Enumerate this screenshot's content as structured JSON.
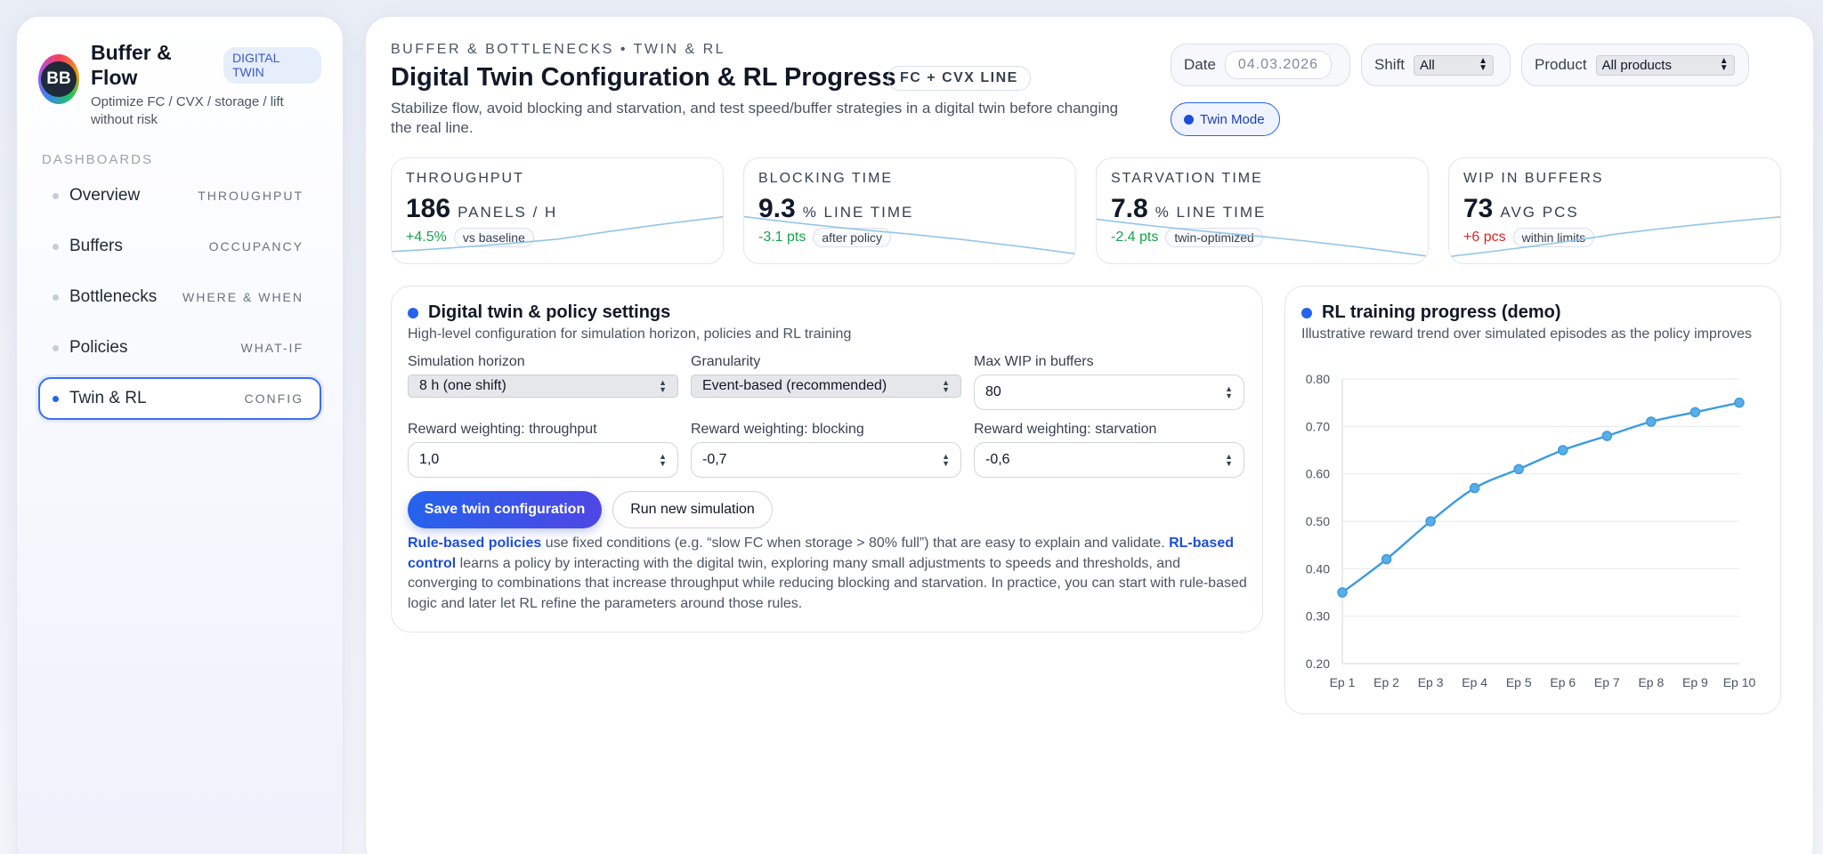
{
  "sidebar": {
    "logo_text": "BB",
    "title": "Buffer & Flow",
    "badge": "DIGITAL TWIN",
    "subtitle": "Optimize FC / CVX / storage / lift without risk",
    "section_heading": "DASHBOARDS",
    "items": [
      {
        "label": "Overview",
        "tag": "THROUGHPUT",
        "active": false
      },
      {
        "label": "Buffers",
        "tag": "OCCUPANCY",
        "active": false
      },
      {
        "label": "Bottlenecks",
        "tag": "WHERE & WHEN",
        "active": false
      },
      {
        "label": "Policies",
        "tag": "WHAT-IF",
        "active": false
      },
      {
        "label": "Twin & RL",
        "tag": "CONFIG",
        "active": true
      }
    ]
  },
  "header": {
    "eyebrow": "BUFFER & BOTTLENECKS • TWIN & RL",
    "title": "Digital Twin Configuration & RL Progress",
    "line_badge": "FC + CVX LINE",
    "subtitle": "Stabilize flow, avoid blocking and starvation, and test speed/buffer strategies in a digital twin before changing the real line.",
    "filters": {
      "date_label": "Date",
      "date_value": "04.03.2026",
      "shift_label": "Shift",
      "shift_value": "All",
      "product_label": "Product",
      "product_value": "All products"
    },
    "twin_mode_label": "Twin Mode"
  },
  "kpis": [
    {
      "label": "THROUGHPUT",
      "value": "186",
      "unit": "PANELS / H",
      "delta": "+4.5%",
      "delta_tone": "good",
      "note": "vs baseline",
      "trend": [
        0.2,
        0.45,
        0.9
      ]
    },
    {
      "label": "BLOCKING TIME",
      "value": "9.3",
      "unit": "% LINE TIME",
      "delta": "-3.1 pts",
      "delta_tone": "good",
      "note": "after policy",
      "trend": [
        0.9,
        0.55,
        0.15
      ]
    },
    {
      "label": "STARVATION TIME",
      "value": "7.8",
      "unit": "% LINE TIME",
      "delta": "-2.4 pts",
      "delta_tone": "good",
      "note": "twin-optimized",
      "trend": [
        0.85,
        0.5,
        0.1
      ]
    },
    {
      "label": "WIP IN BUFFERS",
      "value": "73",
      "unit": "AVG PCS",
      "delta": "+6 pcs",
      "delta_tone": "bad",
      "note": "within limits",
      "trend": [
        0.1,
        0.55,
        0.9
      ]
    }
  ],
  "settings": {
    "title": "Digital twin & policy settings",
    "subtitle": "High-level configuration for simulation horizon, policies and RL training",
    "horizon_label": "Simulation horizon",
    "horizon_value": "8 h (one shift)",
    "granularity_label": "Granularity",
    "granularity_value": "Event-based (recommended)",
    "max_wip_label": "Max WIP in buffers",
    "max_wip_value": "80",
    "rw_throughput_label": "Reward weighting: throughput",
    "rw_throughput_value": "1,0",
    "rw_blocking_label": "Reward weighting: blocking",
    "rw_blocking_value": "-0,7",
    "rw_starvation_label": "Reward weighting: starvation",
    "rw_starvation_value": "-0,6",
    "save_label": "Save twin configuration",
    "run_label": "Run new simulation",
    "explain_hl1": "Rule-based policies",
    "explain_t1": " use fixed conditions (e.g. “slow FC when storage > 80% full”) that are easy to explain and validate. ",
    "explain_hl2": "RL-based control",
    "explain_t2": " learns a policy by interacting with the digital twin, exploring many small adjustments to speeds and thresholds, and converging to combinations that increase throughput while reducing blocking and starvation. In practice, you can start with rule-based logic and later let RL refine the parameters around those rules."
  },
  "rl_panel": {
    "title": "RL training progress (demo)",
    "subtitle": "Illustrative reward trend over simulated episodes as the policy improves"
  },
  "chart_data": {
    "type": "line",
    "title": "RL training progress (demo)",
    "categories": [
      "Ep 1",
      "Ep 2",
      "Ep 3",
      "Ep 4",
      "Ep 5",
      "Ep 6",
      "Ep 7",
      "Ep 8",
      "Ep 9",
      "Ep 10"
    ],
    "series": [
      {
        "values": [
          0.35,
          0.42,
          0.5,
          0.57,
          0.61,
          0.65,
          0.68,
          0.71,
          0.73,
          0.75
        ]
      }
    ],
    "ylim": [
      0.2,
      0.8
    ],
    "yticks": [
      "0.80",
      "0.70",
      "0.60",
      "0.50",
      "0.40",
      "0.30",
      "0.20"
    ],
    "grid": true,
    "line_color": "#3b9be0",
    "xlabel": "",
    "ylabel": ""
  }
}
